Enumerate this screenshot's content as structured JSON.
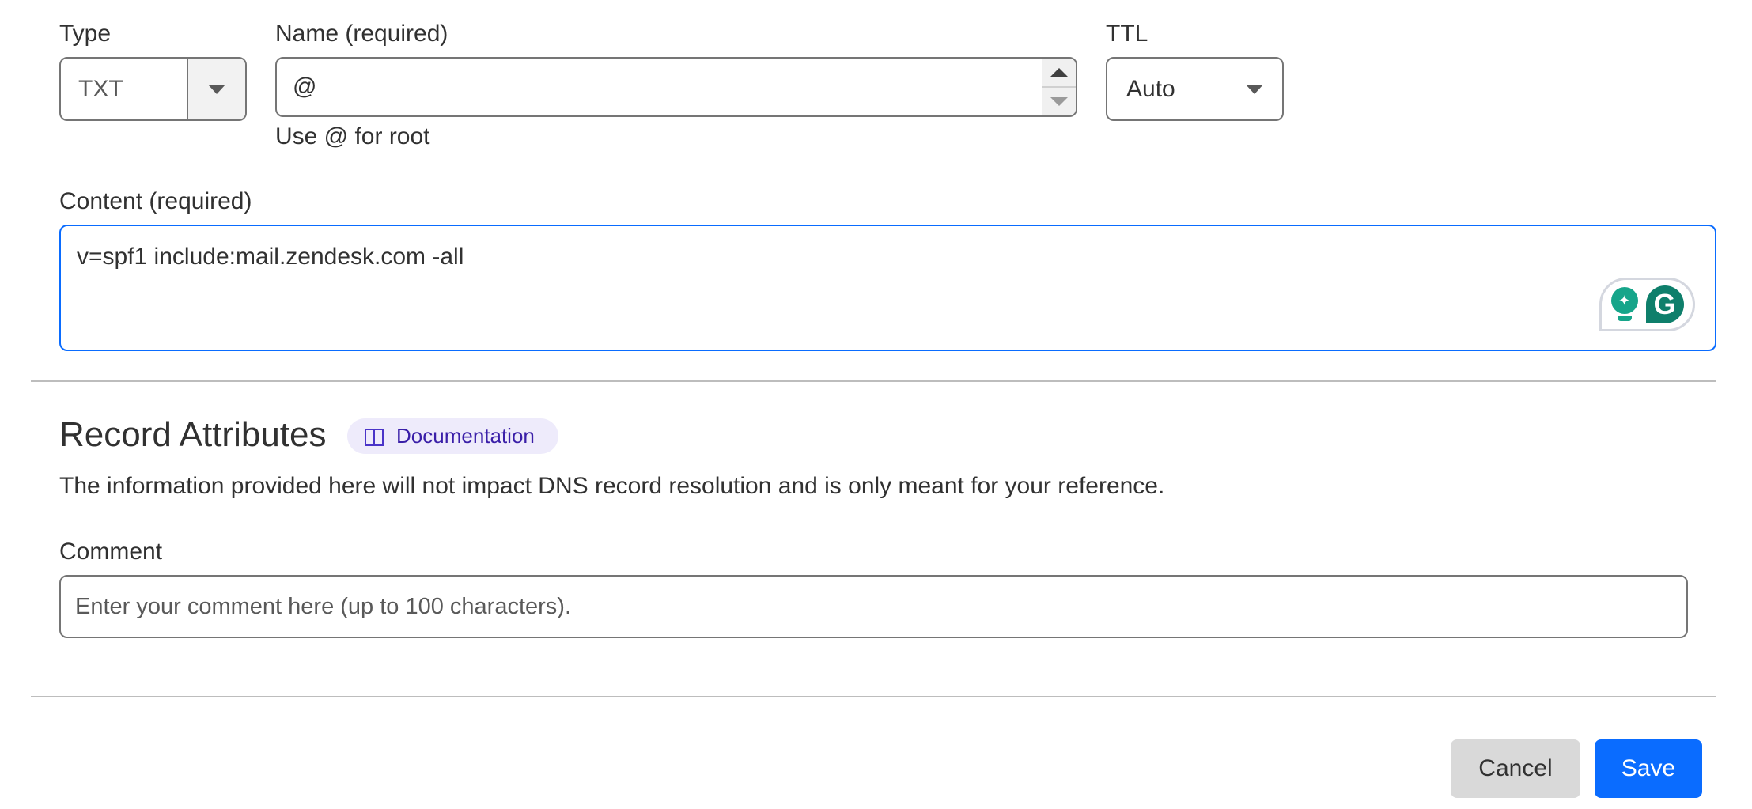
{
  "form": {
    "type": {
      "label": "Type",
      "value": "TXT"
    },
    "name": {
      "label": "Name (required)",
      "value": "@",
      "hint": "Use @ for root"
    },
    "ttl": {
      "label": "TTL",
      "value": "Auto"
    },
    "content": {
      "label": "Content (required)",
      "value": "v=spf1 include:mail.zendesk.com -all"
    }
  },
  "attributes": {
    "title": "Record Attributes",
    "doc_link": "Documentation",
    "description": "The information provided here will not impact DNS record resolution and is only meant for your reference.",
    "comment": {
      "label": "Comment",
      "value": "",
      "placeholder": "Enter your comment here (up to 100 characters)."
    }
  },
  "actions": {
    "cancel": "Cancel",
    "save": "Save"
  },
  "colors": {
    "accent": "#0a6cff",
    "doc_pill_bg": "#eeebfb",
    "doc_pill_text": "#3a1fa8",
    "grammarly": "#0e7f6b"
  },
  "icons": {
    "select_caret": "caret-down-icon",
    "spinner": "spinner-arrows-icon",
    "doc": "book-icon",
    "grammarly_assist": "lightbulb-sparkle-icon",
    "grammarly": "grammarly-g-icon"
  }
}
